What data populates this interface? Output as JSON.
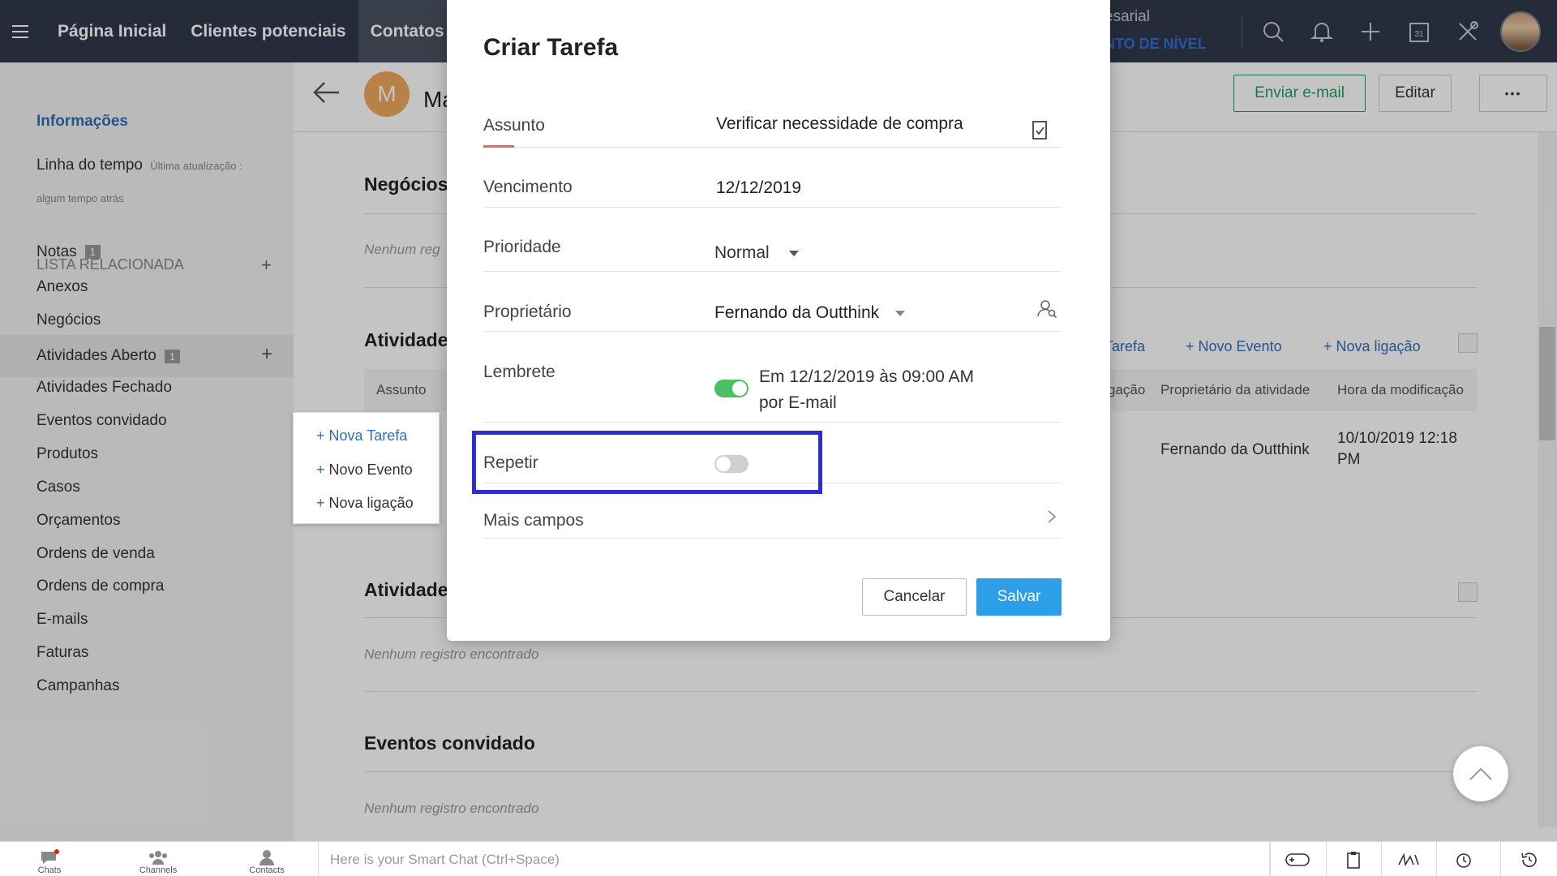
{
  "nav": {
    "tabs": [
      "Página Inicial",
      "Clientes potenciais",
      "Contatos"
    ],
    "org_line1": "esarial",
    "org_line2": "NTO DE NÍVEL"
  },
  "sidebar": {
    "info": "Informações",
    "timeline": "Linha do tempo",
    "timeline_note": "Última atualização :",
    "timeline_note2": "algum tempo atrás",
    "related_header": "LISTA RELACIONADA",
    "items": [
      {
        "label": "Notas",
        "badge": "1"
      },
      {
        "label": "Anexos"
      },
      {
        "label": "Negócios"
      },
      {
        "label": "Atividades Aberto",
        "badge": "1"
      },
      {
        "label": "Atividades Fechado"
      },
      {
        "label": "Eventos convidado"
      },
      {
        "label": "Produtos"
      },
      {
        "label": "Casos"
      },
      {
        "label": "Orçamentos"
      },
      {
        "label": "Ordens de venda"
      },
      {
        "label": "Ordens de compra"
      },
      {
        "label": "E-mails"
      },
      {
        "label": "Faturas"
      },
      {
        "label": "Campanhas"
      }
    ]
  },
  "popup_menu": {
    "items": [
      "Nova Tarefa",
      "Novo Evento",
      "Nova ligação"
    ]
  },
  "detail": {
    "avatar_letter": "M",
    "name_partial": "Ma",
    "send_email": "Enviar e-mail",
    "edit": "Editar",
    "more": "•••",
    "sections": {
      "negocios": "Negócios",
      "atividades": "Atividade",
      "atividades2": "Atividade",
      "eventos": "Eventos convidado"
    },
    "no_records": "Nenhum registro encontrado",
    "no_records_partial": "Nenhum reg",
    "activity_actions": [
      "Tarefa",
      "Novo Evento",
      "Nova ligação"
    ],
    "table_headers": [
      "Assunto",
      "gação",
      "Proprietário da atividade",
      "Hora da modificação"
    ],
    "table_row": {
      "owner": "Fernando da Outthink",
      "modified_line1": "10/10/2019 12:18",
      "modified_line2": "PM"
    }
  },
  "modal": {
    "title": "Criar Tarefa",
    "fields": {
      "assunto": {
        "label": "Assunto",
        "value": "Verificar necessidade de compra"
      },
      "vencimento": {
        "label": "Vencimento",
        "value": "12/12/2019"
      },
      "prioridade": {
        "label": "Prioridade",
        "value": "Normal"
      },
      "proprietario": {
        "label": "Proprietário",
        "value": "Fernando da Outthink"
      },
      "lembrete": {
        "label": "Lembrete",
        "line1": "Em 12/12/2019 às 09:00 AM",
        "line2": "por E-mail",
        "on": true
      },
      "repetir": {
        "label": "Repetir",
        "on": false
      }
    },
    "more_fields": "Mais campos",
    "cancel": "Cancelar",
    "save": "Salvar",
    "toggle_on_color": "#4cbf62",
    "toggle_off_color": "#cfcfcf",
    "highlight_color": "#2b2fd1"
  },
  "bottom": {
    "chats": "Chats",
    "channels": "Channels",
    "contacts": "Contacts",
    "smartchat_placeholder": "Here is your Smart Chat (Ctrl+Space)"
  }
}
